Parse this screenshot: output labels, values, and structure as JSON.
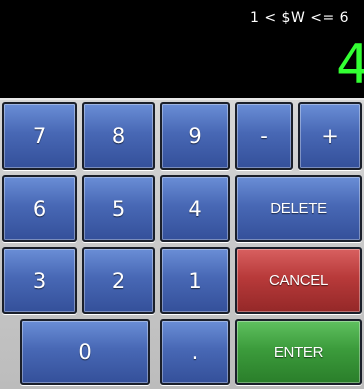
{
  "display": {
    "constraint_text": "1 < $W <= 6",
    "current_value": "4",
    "value_color": "#33ff33"
  },
  "keys": {
    "seven": "7",
    "eight": "8",
    "nine": "9",
    "minus": "-",
    "plus": "+",
    "six": "6",
    "five": "5",
    "four": "4",
    "delete": "DELETE",
    "three": "3",
    "two": "2",
    "one": "1",
    "cancel": "CANCEL",
    "zero": "0",
    "decimal": ".",
    "enter": "ENTER"
  },
  "colors": {
    "key_blue": "#4868b5",
    "key_red": "#b83a3a",
    "key_green": "#3c9c3c",
    "display_bg": "#000000"
  }
}
